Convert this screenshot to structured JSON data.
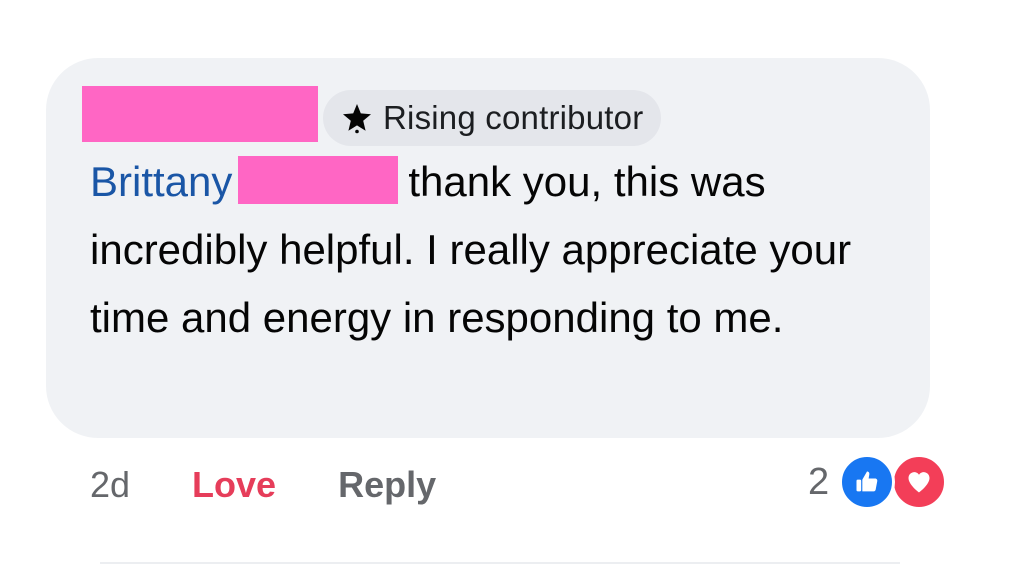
{
  "comment": {
    "badge_label": "Rising contributor",
    "badge_icon": "star-icon",
    "mention": "Brittany",
    "body_text": "thank you, this was incredibly helpful. I really appreciate your time and energy in responding to me."
  },
  "actions": {
    "timestamp": "2d",
    "love_label": "Love",
    "reply_label": "Reply"
  },
  "reactions": {
    "count": "2",
    "icons": [
      "thumbs-up-icon",
      "heart-icon"
    ]
  },
  "colors": {
    "bubble_bg": "#f0f2f5",
    "mention": "#1a56a6",
    "love_action": "#e63d5a",
    "like_blue": "#1877f2",
    "love_red": "#f33e58",
    "redaction": "#ff66c4"
  }
}
